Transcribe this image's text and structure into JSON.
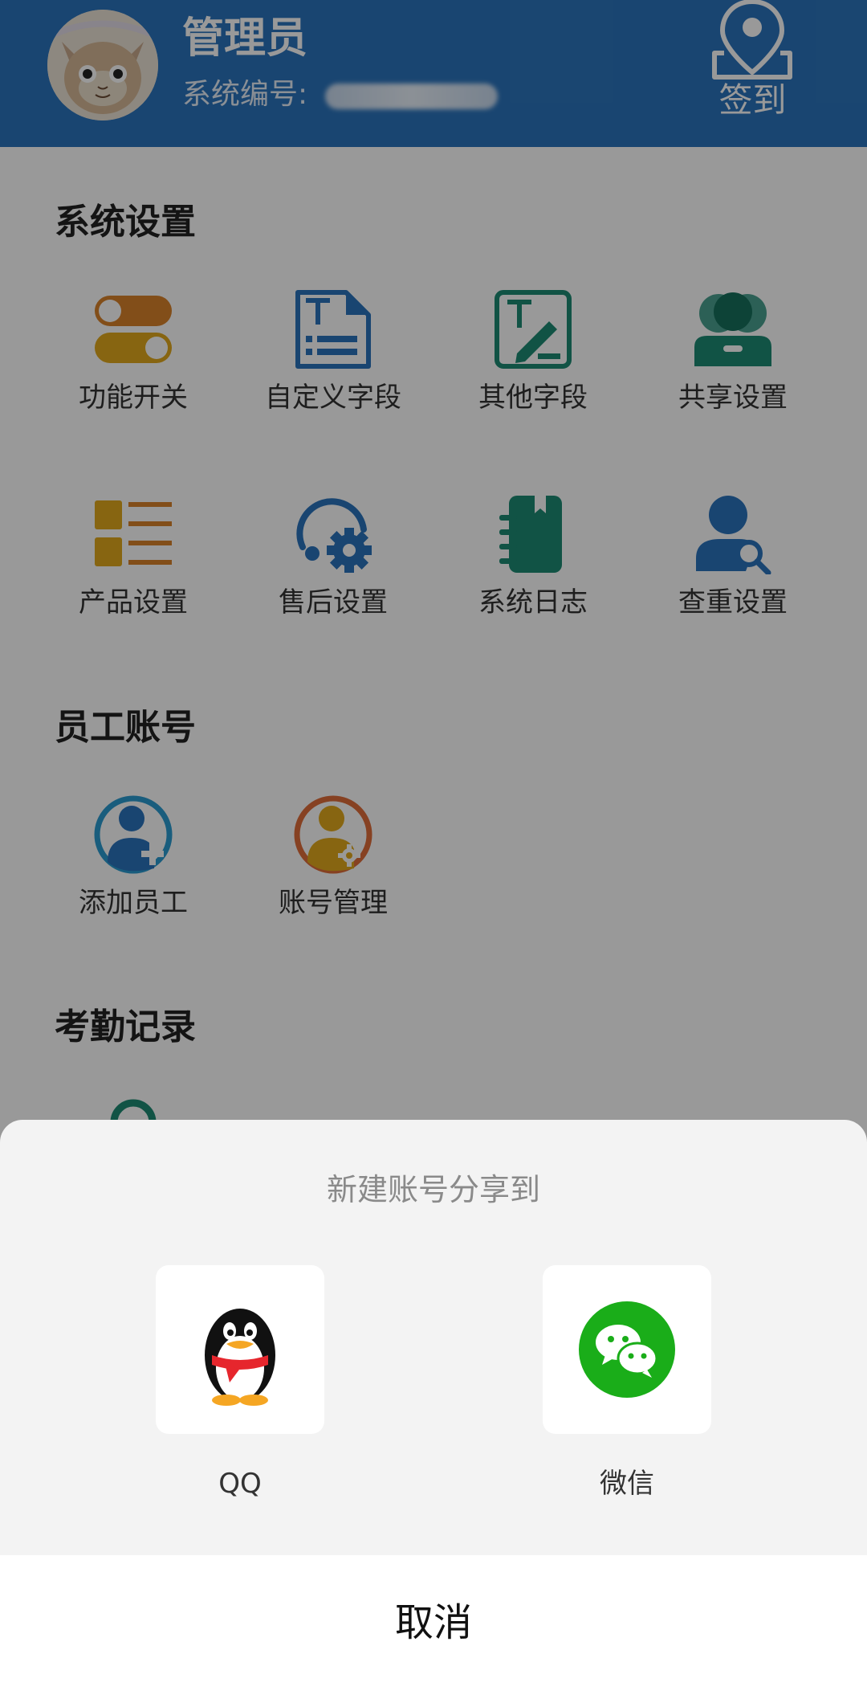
{
  "header": {
    "title": "管理员",
    "system_no_label": "系统编号:",
    "checkin_label": "签到"
  },
  "sections": {
    "system_settings": {
      "title": "系统设置",
      "items": [
        {
          "label": "功能开关",
          "icon": "toggle-switch-icon"
        },
        {
          "label": "自定义字段",
          "icon": "custom-field-doc-icon"
        },
        {
          "label": "其他字段",
          "icon": "edit-field-icon"
        },
        {
          "label": "共享设置",
          "icon": "shared-users-icon"
        },
        {
          "label": "产品设置",
          "icon": "product-list-icon"
        },
        {
          "label": "售后设置",
          "icon": "after-sales-gear-icon"
        },
        {
          "label": "系统日志",
          "icon": "log-notebook-icon"
        },
        {
          "label": "查重设置",
          "icon": "user-search-icon"
        }
      ]
    },
    "staff_accounts": {
      "title": "员工账号",
      "items": [
        {
          "label": "添加员工",
          "icon": "add-user-icon"
        },
        {
          "label": "账号管理",
          "icon": "account-manage-icon"
        }
      ]
    },
    "attendance": {
      "title": "考勤记录"
    }
  },
  "share_sheet": {
    "title": "新建账号分享到",
    "options": [
      {
        "label": "QQ",
        "icon": "qq-penguin-icon"
      },
      {
        "label": "微信",
        "icon": "wechat-icon"
      }
    ],
    "cancel_label": "取消"
  },
  "colors": {
    "header_bg": "#2b74bd",
    "orange": "#d9822b",
    "yellow": "#e2a91d",
    "blue": "#2b74bd",
    "teal": "#1d8a73",
    "wechat_green": "#1aad19"
  }
}
